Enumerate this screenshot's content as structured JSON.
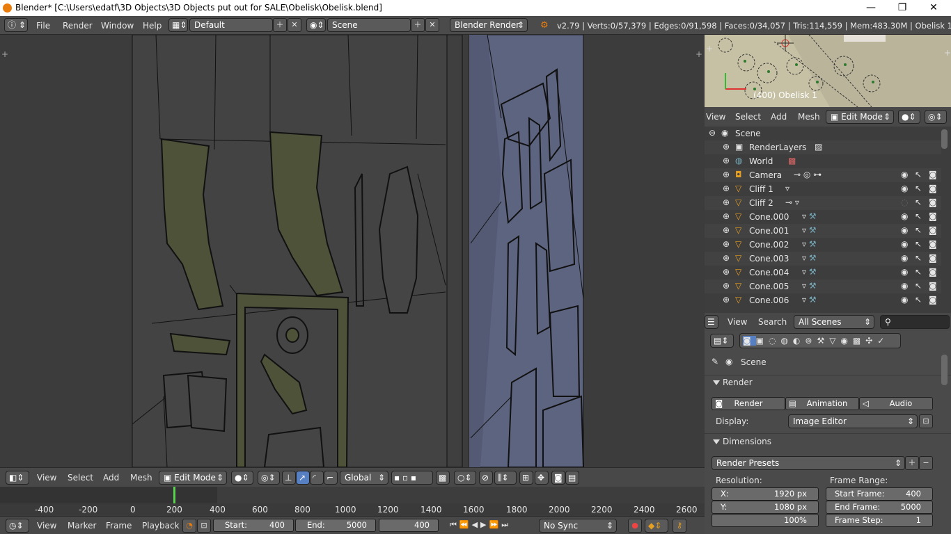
{
  "window": {
    "title": "Blender* [C:\\Users\\edatf\\3D Objects\\3D Objects put out for SALE\\Obelisk\\Obelisk.blend]",
    "minimize": "—",
    "restore": "❐",
    "close": "✕"
  },
  "info_header": {
    "menus": [
      "File",
      "Render",
      "Window",
      "Help"
    ],
    "layout": "Default",
    "scene": "Scene",
    "engine": "Blender Render",
    "stats": "v2.79 | Verts:0/57,379 | Edges:0/91,598 | Faces:0/34,057 | Tris:114,559 | Mem:483.30M | Obelisk 1"
  },
  "viewport_header": {
    "menus": [
      "View",
      "Select",
      "Add",
      "Mesh"
    ],
    "mode": "Edit Mode",
    "orientation": "Global"
  },
  "timeline": {
    "ruler_labels": [
      "-400",
      "-200",
      "0",
      "200",
      "400",
      "600",
      "800",
      "1000",
      "1200",
      "1400",
      "1600",
      "1800",
      "2000",
      "2200",
      "2400",
      "2600"
    ],
    "menus": [
      "View",
      "Marker",
      "Frame",
      "Playback"
    ],
    "start_label": "Start:",
    "start_value": "400",
    "end_label": "End:",
    "end_value": "5000",
    "current_frame": "400",
    "sync": "No Sync"
  },
  "mini_viewport": {
    "label": "(400) Obelisk 1",
    "menus": [
      "View",
      "Select",
      "Add",
      "Mesh"
    ],
    "mode": "Edit Mode"
  },
  "outliner": {
    "items": [
      {
        "name": "Scene"
      },
      {
        "name": "RenderLayers"
      },
      {
        "name": "World"
      },
      {
        "name": "Camera"
      },
      {
        "name": "Cliff 1"
      },
      {
        "name": "Cliff 2"
      },
      {
        "name": "Cone.000"
      },
      {
        "name": "Cone.001"
      },
      {
        "name": "Cone.002"
      },
      {
        "name": "Cone.003"
      },
      {
        "name": "Cone.004"
      },
      {
        "name": "Cone.005"
      },
      {
        "name": "Cone.006"
      }
    ],
    "footer_menus": [
      "View",
      "Search"
    ],
    "filter": "All Scenes"
  },
  "properties": {
    "context_label": "Scene",
    "render_panel": "Render",
    "render_buttons": [
      "Render",
      "Animation",
      "Audio"
    ],
    "display_label": "Display:",
    "display_value": "Image Editor",
    "dimensions_panel": "Dimensions",
    "render_presets": "Render Presets",
    "resolution_label": "Resolution:",
    "res_x_label": "X:",
    "res_x": "1920 px",
    "res_y_label": "Y:",
    "res_y": "1080 px",
    "res_pct": "100%",
    "frame_range_label": "Frame Range:",
    "start_frame_label": "Start Frame:",
    "start_frame": "400",
    "end_frame_label": "End Frame:",
    "end_frame": "5000",
    "frame_step_label": "Frame Step:",
    "frame_step": "1"
  },
  "colors": {
    "accent_blue": "#5680c2",
    "timeline_cursor": "#5bd150",
    "relief_fill": "#4d5239",
    "mesh_panel_blue": "#5d6480"
  }
}
